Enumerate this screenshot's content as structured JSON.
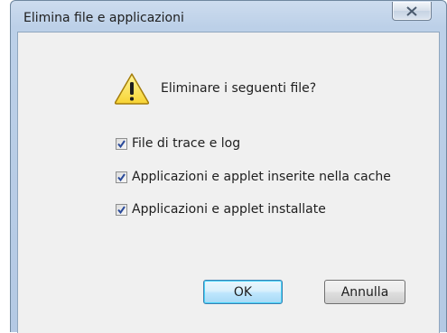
{
  "window": {
    "title": "Elimina file e applicazioni"
  },
  "dialog": {
    "icon": "warning-icon",
    "question": "Eliminare i seguenti file?",
    "options": [
      {
        "label": "File di trace e log",
        "checked": true
      },
      {
        "label": "Applicazioni e applet inserite nella cache",
        "checked": true
      },
      {
        "label": "Applicazioni e applet installate",
        "checked": true
      }
    ]
  },
  "buttons": {
    "ok_label": "OK",
    "cancel_label": "Annulla"
  },
  "colors": {
    "frame": "#b4c9e4",
    "client": "#f0f0f0",
    "accent": "#3c7fb1"
  }
}
